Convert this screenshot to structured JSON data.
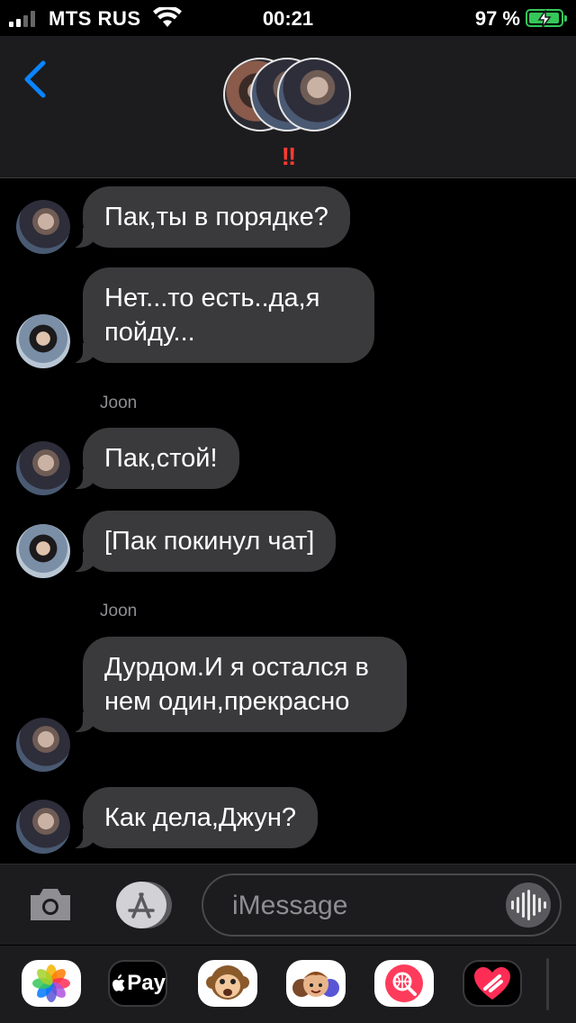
{
  "status_bar": {
    "carrier": "MTS RUS",
    "time": "00:21",
    "battery_percent": "97 %",
    "signal_bars": 2,
    "colors": {
      "battery": "#34c759"
    }
  },
  "header": {
    "alert_marks": "!!",
    "colors": {
      "alert": "#ff3b30",
      "back": "#0a84ff"
    }
  },
  "messages": [
    {
      "avatar": "joon-avatar",
      "text": "Пак,ты в порядке?"
    },
    {
      "avatar": "pak-avatar",
      "text": "Нет...то есть..да,я пойду..."
    },
    {
      "sender": "Joon"
    },
    {
      "avatar": "joon-avatar",
      "text": "Пак,стой!"
    },
    {
      "avatar": "pak-avatar",
      "text": "[Пак покинул чат]"
    },
    {
      "sender": "Joon"
    },
    {
      "avatar": "joon-avatar",
      "text": "Дурдом.И я остался в нем один,прекрасно"
    },
    {
      "avatar": "joon-avatar",
      "text": "Как дела,Джун?"
    }
  ],
  "composer": {
    "placeholder": "iMessage"
  },
  "app_drawer": {
    "items": [
      "photos-app",
      "apple-pay-app",
      "animoji-app",
      "memoji-app",
      "web-search-app",
      "digital-touch-app"
    ],
    "apple_pay_label": "Pay"
  }
}
